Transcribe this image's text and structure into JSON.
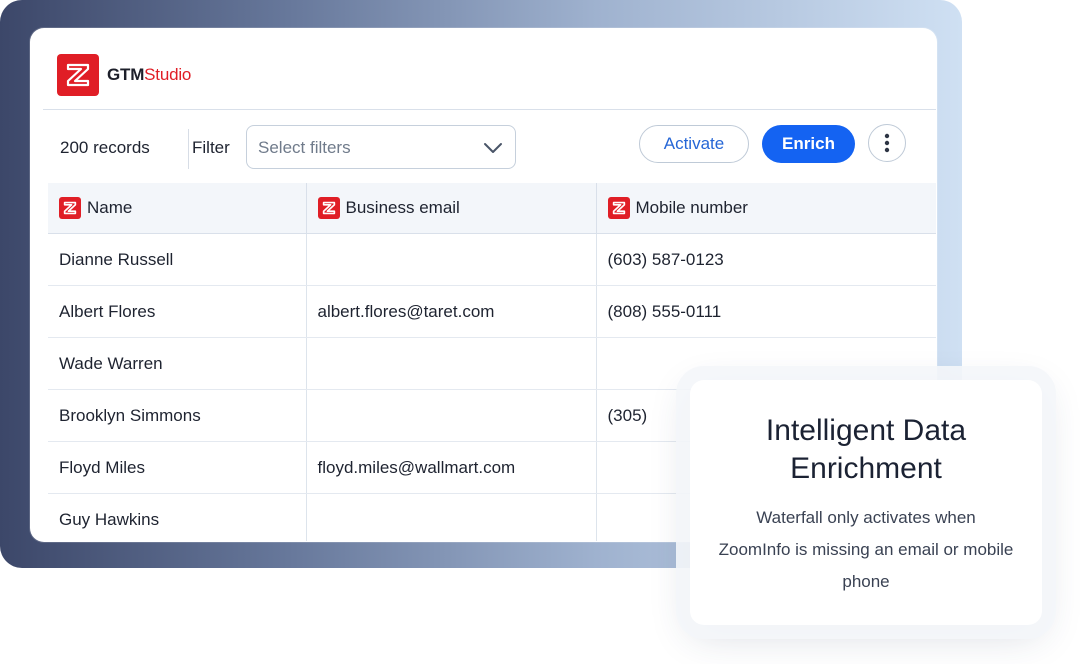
{
  "brand": {
    "name_bold": "GTM",
    "name_accent": "Studio",
    "logo_icon": "zoominfo-logo-icon",
    "accent_color": "#e01e26"
  },
  "toolbar": {
    "records": "200 records",
    "filter_label": "Filter",
    "filter_placeholder": "Select filters",
    "activate_label": "Activate",
    "enrich_label": "Enrich",
    "primary_color": "#1463f2"
  },
  "table": {
    "headers": [
      "Name",
      "Business email",
      "Mobile number"
    ],
    "rows": [
      {
        "name": "Dianne Russell",
        "email": "",
        "mobile": "(603) 587-0123"
      },
      {
        "name": "Albert Flores",
        "email": "albert.flores@taret.com",
        "mobile": "(808) 555-0111"
      },
      {
        "name": "Wade Warren",
        "email": "",
        "mobile": ""
      },
      {
        "name": "Brooklyn Simmons",
        "email": "",
        "mobile": "(305)"
      },
      {
        "name": "Floyd Miles",
        "email": "floyd.miles@wallmart.com",
        "mobile": ""
      },
      {
        "name": "Guy Hawkins",
        "email": "",
        "mobile": ""
      }
    ]
  },
  "card": {
    "title_line1": "Intelligent Data",
    "title_line2": "Enrichment",
    "body": "Waterfall only activates when ZoomInfo is missing an email or mobile phone"
  }
}
